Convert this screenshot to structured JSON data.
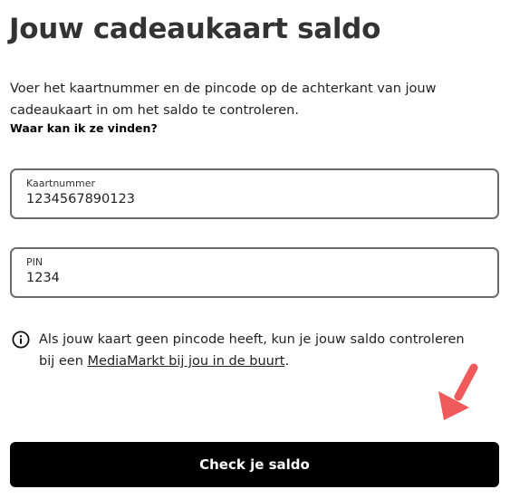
{
  "page": {
    "title": "Jouw cadeaukaart saldo"
  },
  "intro": {
    "text": "Voer het kaartnummer en de pincode op de achterkant van jouw cadeaukaart in om het saldo te controleren.",
    "where_link": "Waar kan ik ze vinden?"
  },
  "card_number": {
    "label": "Kaartnummer",
    "value": "1234567890123"
  },
  "pin": {
    "label": "PIN",
    "value": "1234"
  },
  "info": {
    "icon": "info-icon",
    "text_before": "Als jouw kaart geen pincode heeft, kun je jouw saldo controleren bij een ",
    "link_text": "MediaMarkt bij jou in de buurt",
    "text_after": "."
  },
  "annotation": {
    "icon": "arrow-down-left-icon",
    "color": "#f05a5a"
  },
  "button": {
    "label": "Check je saldo",
    "background": "#000000",
    "color": "#ffffff"
  }
}
